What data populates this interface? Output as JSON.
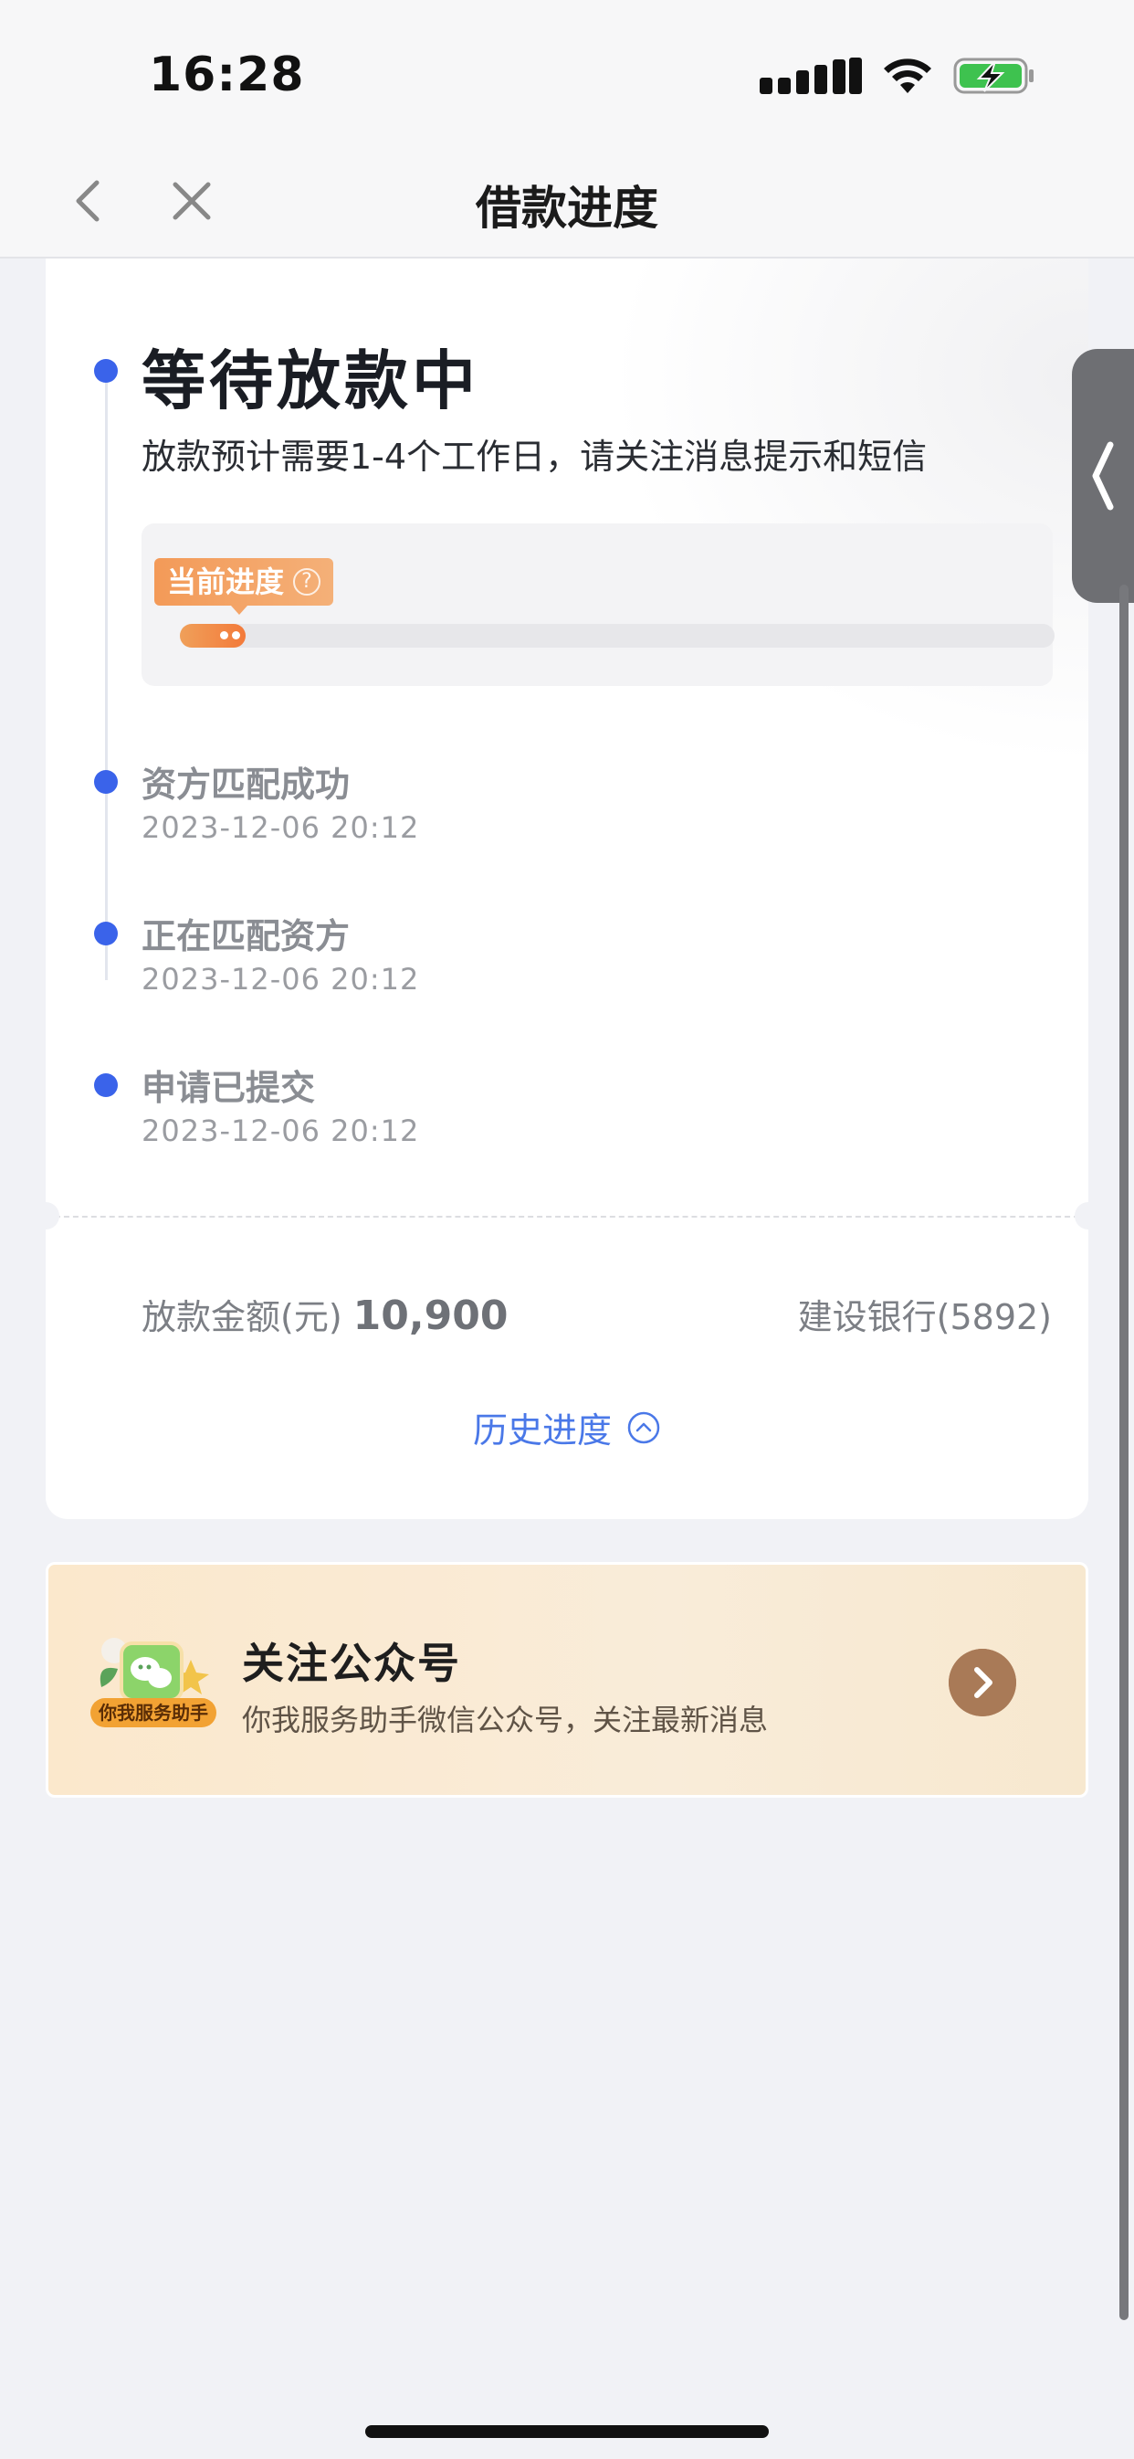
{
  "status_bar": {
    "time": "16:28"
  },
  "nav": {
    "title": "借款进度"
  },
  "current_step": {
    "title": "等待放款中",
    "subtitle": "放款预计需要1-4个工作日，请关注消息提示和短信",
    "progress_badge": "当前进度",
    "progress_fraction": 0.075
  },
  "steps": [
    {
      "title": "资方匹配成功",
      "time": "2023-12-06 20:12"
    },
    {
      "title": "正在匹配资方",
      "time": "2023-12-06 20:12"
    },
    {
      "title": "申请已提交",
      "time": "2023-12-06 20:12"
    }
  ],
  "loan": {
    "amount_label": "放款金额(元)",
    "amount_value": "10,900",
    "bank": "建设银行(5892)"
  },
  "history_link": "历史进度",
  "promo": {
    "logo_text": "你我服务助手",
    "title": "关注公众号",
    "subtitle": "你我服务助手微信公众号，关注最新消息"
  },
  "colors": {
    "accent_blue": "#3a63ea",
    "progress_orange": "#f37a3a",
    "promo_bg": "#fbe8cc"
  }
}
